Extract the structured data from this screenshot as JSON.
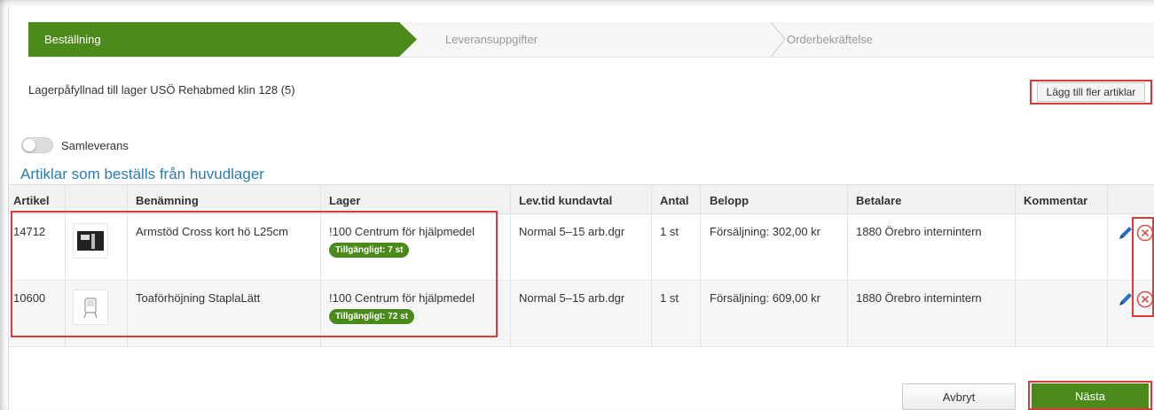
{
  "stepper": {
    "steps": [
      {
        "label": "Beställning"
      },
      {
        "label": "Leveransuppgifter"
      },
      {
        "label": "Orderbekräftelse"
      }
    ]
  },
  "request_title": "Lagerpåfyllnad till lager USÖ Rehabmed klin 128 (5)",
  "add_articles_label": "Lägg till fler artiklar",
  "toggle": {
    "label": "Samleverans",
    "on": false
  },
  "section_title": "Artiklar som beställs från huvudlager",
  "table": {
    "headers": [
      "Artikel",
      "",
      "Benämning",
      "Lager",
      "Lev.tid kundavtal",
      "Antal",
      "Belopp",
      "Betalare",
      "Kommentar",
      ""
    ],
    "rows": [
      {
        "artikel": "14712",
        "benamning": "Armstöd Cross kort hö L25cm",
        "lager": "!100 Centrum för hjälpmedel",
        "availability": "Tillgängligt: 7 st",
        "levtid": "Normal 5–15 arb.dgr",
        "antal": "1 st",
        "belopp": "Försäljning: 302,00 kr",
        "betalare": "1880 Örebro internintern",
        "kommentar": ""
      },
      {
        "artikel": "10600",
        "benamning": "Toaförhöjning StaplaLätt",
        "lager": "!100 Centrum för hjälpmedel",
        "availability": "Tillgängligt: 72 st",
        "levtid": "Normal 5–15 arb.dgr",
        "antal": "1 st",
        "belopp": "Försäljning: 609,00 kr",
        "betalare": "1880 Örebro internintern",
        "kommentar": ""
      }
    ]
  },
  "actions": {
    "cancel_label": "Avbryt",
    "next_label": "Nästa"
  },
  "colors": {
    "accent_green": "#4d8a1c",
    "link_blue": "#2e7bb0",
    "annotation_red": "#e0383b"
  },
  "icons": {
    "edit": "pencil-icon",
    "delete": "remove-circle-icon"
  }
}
